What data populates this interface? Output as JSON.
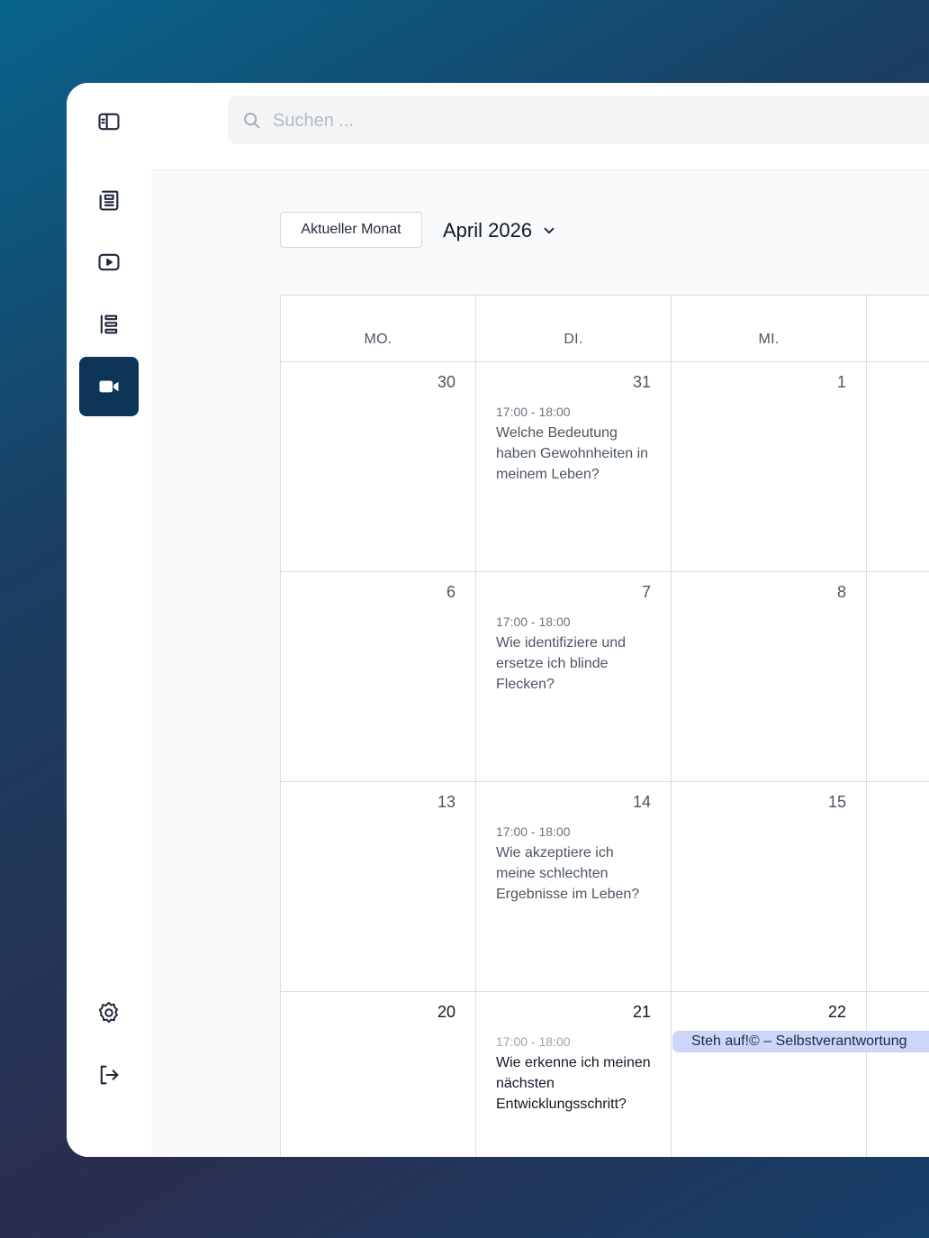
{
  "sidebar": {
    "items": [
      {
        "icon": "panel-toggle-icon"
      },
      {
        "icon": "newspaper-icon"
      },
      {
        "icon": "video-play-icon"
      },
      {
        "icon": "list-icon"
      },
      {
        "icon": "video-camera-icon",
        "active": true
      },
      {
        "icon": "gear-icon"
      },
      {
        "icon": "logout-icon"
      }
    ]
  },
  "search": {
    "placeholder": "Suchen ..."
  },
  "toolbar": {
    "current_month_label": "Aktueller Monat",
    "month_label": "April 2026"
  },
  "calendar": {
    "weekdays": [
      "MO.",
      "DI.",
      "MI."
    ],
    "weeks": [
      {
        "days": [
          {
            "num": "30"
          },
          {
            "num": "31",
            "event": {
              "time": "17:00 - 18:00",
              "title": "Welche Bedeutung haben Gewohnheiten in meinem Leben?"
            }
          },
          {
            "num": "1"
          }
        ]
      },
      {
        "days": [
          {
            "num": "6"
          },
          {
            "num": "7",
            "event": {
              "time": "17:00 - 18:00",
              "title": "Wie identifiziere und ersetze ich blinde Flecken?"
            }
          },
          {
            "num": "8"
          }
        ]
      },
      {
        "days": [
          {
            "num": "13"
          },
          {
            "num": "14",
            "event": {
              "time": "17:00 - 18:00",
              "title": "Wie akzeptiere ich meine schlechten Ergebnisse im Leben?"
            }
          },
          {
            "num": "15"
          }
        ]
      },
      {
        "days": [
          {
            "num": "20"
          },
          {
            "num": "21",
            "event": {
              "time": "17:00 - 18:00",
              "title": "Wie erkenne ich meinen nächsten Entwicklungsschritt?"
            }
          },
          {
            "num": "22",
            "banner": "Steh auf!© – Selbstverantwortung"
          }
        ]
      }
    ]
  },
  "colors": {
    "accent": "#0c3557",
    "banner": "#cdd5fb",
    "border": "#d9dce1"
  }
}
